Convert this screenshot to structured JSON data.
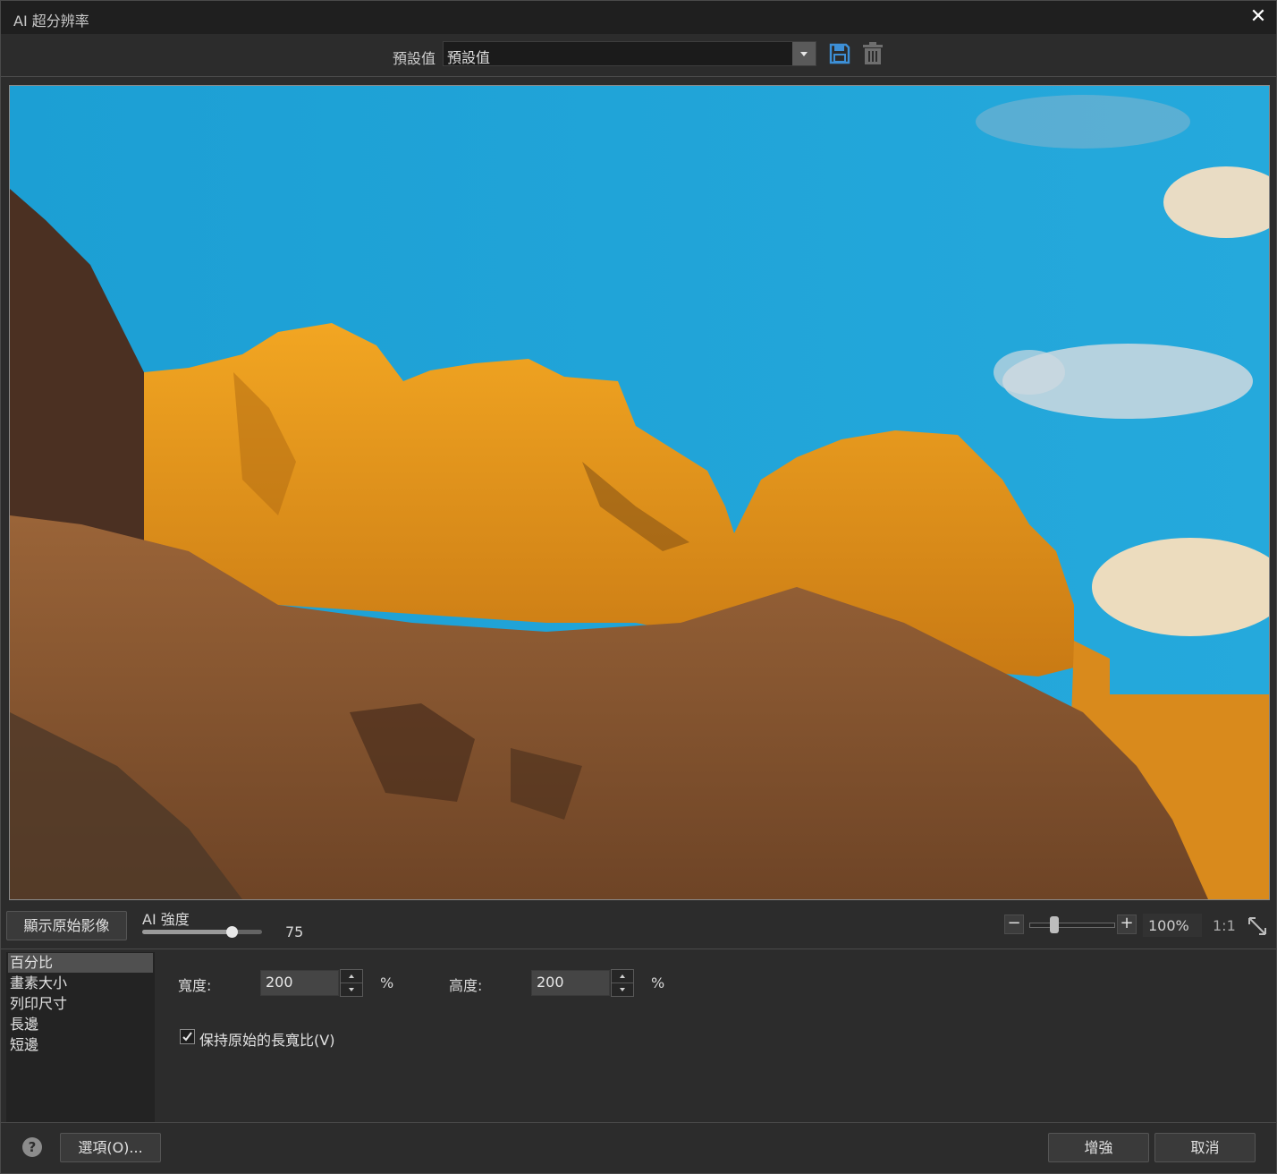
{
  "window": {
    "title": "AI 超分辨率",
    "close_glyph": "✕"
  },
  "preset": {
    "label": "預設值",
    "value": "預設值",
    "save_icon": "save-icon",
    "delete_icon": "trash-icon"
  },
  "preview": {
    "description_icon": "landscape-preview-image"
  },
  "controls": {
    "show_original_label": "顯示原始影像",
    "strength_label": "AI 強度",
    "strength_value": "75",
    "strength_fraction": 0.75,
    "zoom_minus": "−",
    "zoom_plus": "+",
    "zoom_value": "100%",
    "zoom_1to1": "1:1",
    "fit_icon": "resize-diagonal-icon"
  },
  "modes": {
    "items": [
      "百分比",
      "畫素大小",
      "列印尺寸",
      "長邊",
      "短邊"
    ],
    "selected_index": 0
  },
  "size": {
    "width_label": "寬度:",
    "width_value": "200",
    "width_unit": "%",
    "height_label": "高度:",
    "height_value": "200",
    "height_unit": "%"
  },
  "aspect": {
    "label": "保持原始的長寬比(V)",
    "checked": true
  },
  "footer": {
    "help_glyph": "?",
    "options_label": "選項(O)...",
    "enhance_label": "增強",
    "cancel_label": "取消"
  },
  "colors": {
    "sky": "#1ea3d6",
    "rock_lit": "#e39a1a",
    "rock_shadow": "#8a5a32",
    "panel": "#2c2c2c",
    "titlebar": "#1f1f1f"
  }
}
